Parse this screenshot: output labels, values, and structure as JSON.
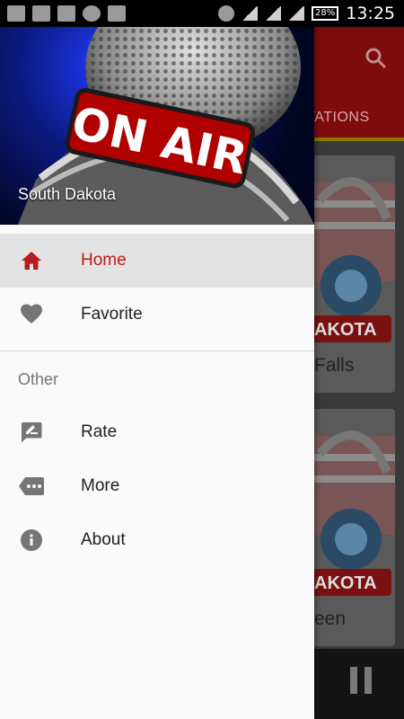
{
  "status_bar": {
    "battery": "28%",
    "time": "13:25"
  },
  "app": {
    "tab_label": "STATIONS",
    "cards": [
      {
        "name": "Falls"
      },
      {
        "name": "een"
      }
    ],
    "card_logo_text": "AKOTA",
    "colors": {
      "appbar": "#b71c1c",
      "tab_indicator": "#ffeb3b"
    }
  },
  "drawer": {
    "header_title": "South Dakota",
    "header_image_text": "ON AIR",
    "items": [
      {
        "label": "Home",
        "icon": "home-icon",
        "active": true
      },
      {
        "label": "Favorite",
        "icon": "heart-icon",
        "active": false
      }
    ],
    "section_title": "Other",
    "other_items": [
      {
        "label": "Rate",
        "icon": "rate-icon"
      },
      {
        "label": "More",
        "icon": "more-icon"
      },
      {
        "label": "About",
        "icon": "info-icon"
      }
    ],
    "colors": {
      "active_text": "#b71c1c",
      "active_bg": "#e3e3e3"
    }
  }
}
